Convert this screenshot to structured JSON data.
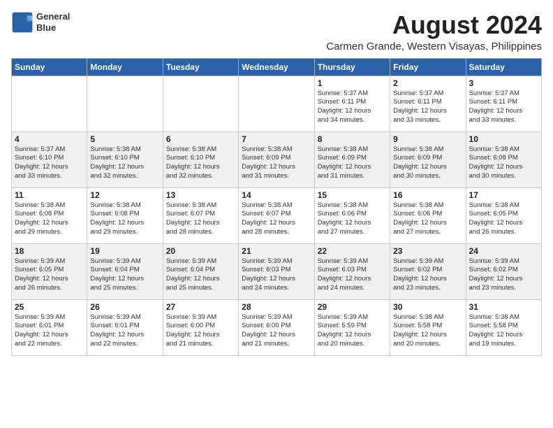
{
  "logo": {
    "line1": "General",
    "line2": "Blue"
  },
  "title": "August 2024",
  "subtitle": "Carmen Grande, Western Visayas, Philippines",
  "days_of_week": [
    "Sunday",
    "Monday",
    "Tuesday",
    "Wednesday",
    "Thursday",
    "Friday",
    "Saturday"
  ],
  "weeks": [
    [
      {
        "day": "",
        "info": ""
      },
      {
        "day": "",
        "info": ""
      },
      {
        "day": "",
        "info": ""
      },
      {
        "day": "",
        "info": ""
      },
      {
        "day": "1",
        "info": "Sunrise: 5:37 AM\nSunset: 6:11 PM\nDaylight: 12 hours\nand 34 minutes."
      },
      {
        "day": "2",
        "info": "Sunrise: 5:37 AM\nSunset: 6:11 PM\nDaylight: 12 hours\nand 33 minutes."
      },
      {
        "day": "3",
        "info": "Sunrise: 5:37 AM\nSunset: 6:11 PM\nDaylight: 12 hours\nand 33 minutes."
      }
    ],
    [
      {
        "day": "4",
        "info": "Sunrise: 5:37 AM\nSunset: 6:10 PM\nDaylight: 12 hours\nand 33 minutes."
      },
      {
        "day": "5",
        "info": "Sunrise: 5:38 AM\nSunset: 6:10 PM\nDaylight: 12 hours\nand 32 minutes."
      },
      {
        "day": "6",
        "info": "Sunrise: 5:38 AM\nSunset: 6:10 PM\nDaylight: 12 hours\nand 32 minutes."
      },
      {
        "day": "7",
        "info": "Sunrise: 5:38 AM\nSunset: 6:09 PM\nDaylight: 12 hours\nand 31 minutes."
      },
      {
        "day": "8",
        "info": "Sunrise: 5:38 AM\nSunset: 6:09 PM\nDaylight: 12 hours\nand 31 minutes."
      },
      {
        "day": "9",
        "info": "Sunrise: 5:38 AM\nSunset: 6:09 PM\nDaylight: 12 hours\nand 30 minutes."
      },
      {
        "day": "10",
        "info": "Sunrise: 5:38 AM\nSunset: 6:08 PM\nDaylight: 12 hours\nand 30 minutes."
      }
    ],
    [
      {
        "day": "11",
        "info": "Sunrise: 5:38 AM\nSunset: 6:08 PM\nDaylight: 12 hours\nand 29 minutes."
      },
      {
        "day": "12",
        "info": "Sunrise: 5:38 AM\nSunset: 6:08 PM\nDaylight: 12 hours\nand 29 minutes."
      },
      {
        "day": "13",
        "info": "Sunrise: 5:38 AM\nSunset: 6:07 PM\nDaylight: 12 hours\nand 28 minutes."
      },
      {
        "day": "14",
        "info": "Sunrise: 5:38 AM\nSunset: 6:07 PM\nDaylight: 12 hours\nand 28 minutes."
      },
      {
        "day": "15",
        "info": "Sunrise: 5:38 AM\nSunset: 6:06 PM\nDaylight: 12 hours\nand 27 minutes."
      },
      {
        "day": "16",
        "info": "Sunrise: 5:38 AM\nSunset: 6:06 PM\nDaylight: 12 hours\nand 27 minutes."
      },
      {
        "day": "17",
        "info": "Sunrise: 5:38 AM\nSunset: 6:05 PM\nDaylight: 12 hours\nand 26 minutes."
      }
    ],
    [
      {
        "day": "18",
        "info": "Sunrise: 5:39 AM\nSunset: 6:05 PM\nDaylight: 12 hours\nand 26 minutes."
      },
      {
        "day": "19",
        "info": "Sunrise: 5:39 AM\nSunset: 6:04 PM\nDaylight: 12 hours\nand 25 minutes."
      },
      {
        "day": "20",
        "info": "Sunrise: 5:39 AM\nSunset: 6:04 PM\nDaylight: 12 hours\nand 25 minutes."
      },
      {
        "day": "21",
        "info": "Sunrise: 5:39 AM\nSunset: 6:03 PM\nDaylight: 12 hours\nand 24 minutes."
      },
      {
        "day": "22",
        "info": "Sunrise: 5:39 AM\nSunset: 6:03 PM\nDaylight: 12 hours\nand 24 minutes."
      },
      {
        "day": "23",
        "info": "Sunrise: 5:39 AM\nSunset: 6:02 PM\nDaylight: 12 hours\nand 23 minutes."
      },
      {
        "day": "24",
        "info": "Sunrise: 5:39 AM\nSunset: 6:02 PM\nDaylight: 12 hours\nand 23 minutes."
      }
    ],
    [
      {
        "day": "25",
        "info": "Sunrise: 5:39 AM\nSunset: 6:01 PM\nDaylight: 12 hours\nand 22 minutes."
      },
      {
        "day": "26",
        "info": "Sunrise: 5:39 AM\nSunset: 6:01 PM\nDaylight: 12 hours\nand 22 minutes."
      },
      {
        "day": "27",
        "info": "Sunrise: 5:39 AM\nSunset: 6:00 PM\nDaylight: 12 hours\nand 21 minutes."
      },
      {
        "day": "28",
        "info": "Sunrise: 5:39 AM\nSunset: 6:00 PM\nDaylight: 12 hours\nand 21 minutes."
      },
      {
        "day": "29",
        "info": "Sunrise: 5:39 AM\nSunset: 5:59 PM\nDaylight: 12 hours\nand 20 minutes."
      },
      {
        "day": "30",
        "info": "Sunrise: 5:38 AM\nSunset: 5:58 PM\nDaylight: 12 hours\nand 20 minutes."
      },
      {
        "day": "31",
        "info": "Sunrise: 5:38 AM\nSunset: 5:58 PM\nDaylight: 12 hours\nand 19 minutes."
      }
    ]
  ]
}
